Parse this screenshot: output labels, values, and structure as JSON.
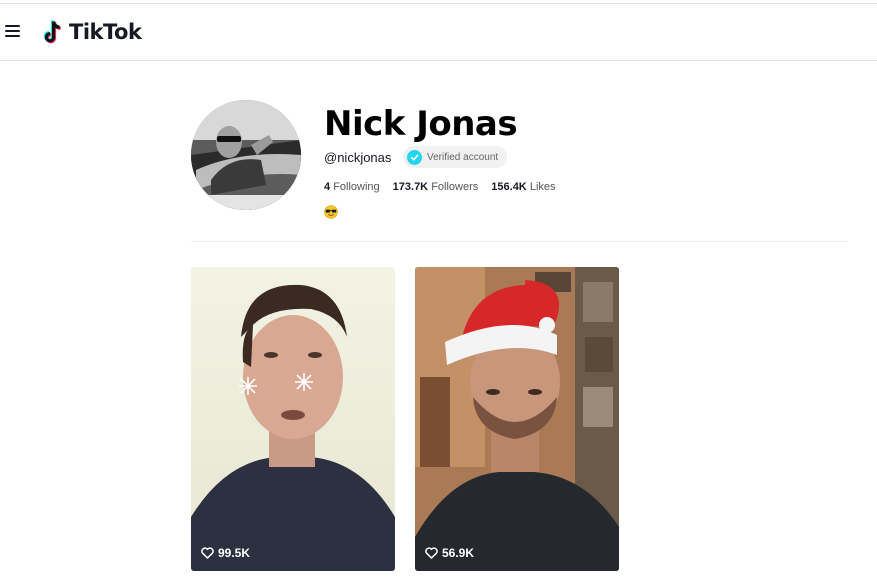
{
  "header": {
    "logo_text": "TikTok"
  },
  "profile": {
    "name": "Nick Jonas",
    "handle": "@nickjonas",
    "verified_label": "Verified account",
    "following_count": "4",
    "following_label": "Following",
    "followers_count": "173.7K",
    "followers_label": "Followers",
    "likes_count": "156.4K",
    "likes_label": "Likes",
    "bio_icon": "sunglasses-emoji"
  },
  "videos": [
    {
      "likes": "99.5K",
      "icon": "heart-icon"
    },
    {
      "likes": "56.9K",
      "icon": "heart-icon"
    }
  ],
  "colors": {
    "text": "#161823",
    "verified_badge": "#20d5ec",
    "logo_cyan": "#25f4ee",
    "logo_red": "#fe2c55"
  }
}
